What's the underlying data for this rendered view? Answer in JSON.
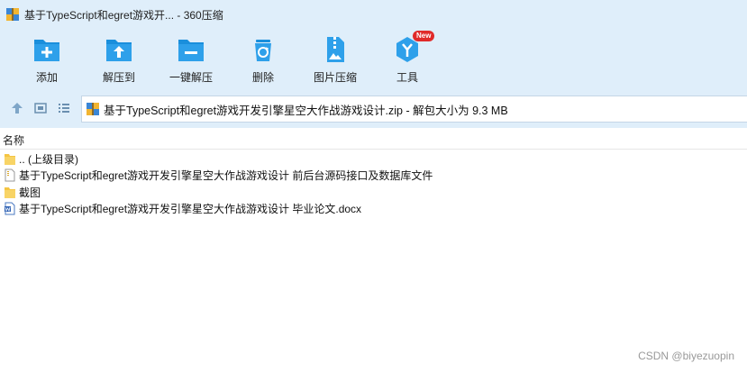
{
  "window": {
    "title": "基于TypeScript和egret游戏开... - 360压缩"
  },
  "toolbar": {
    "items": [
      {
        "label": "添加",
        "icon": "add-icon"
      },
      {
        "label": "解压到",
        "icon": "extract-to-icon"
      },
      {
        "label": "一键解压",
        "icon": "one-click-extract-icon"
      },
      {
        "label": "删除",
        "icon": "delete-icon"
      },
      {
        "label": "图片压缩",
        "icon": "image-compress-icon"
      },
      {
        "label": "工具",
        "icon": "tools-icon",
        "badge": "New"
      }
    ]
  },
  "address": {
    "path": "基于TypeScript和egret游戏开发引擎星空大作战游戏设计.zip - 解包大小为 9.3 MB"
  },
  "list": {
    "column_name": "名称",
    "rows": [
      {
        "label": ".. (上级目录)",
        "icon": "folder-icon"
      },
      {
        "label": "基于TypeScript和egret游戏开发引擎星空大作战游戏设计 前后台源码接口及数据库文件",
        "icon": "file-icon"
      },
      {
        "label": "截图",
        "icon": "folder-icon"
      },
      {
        "label": "基于TypeScript和egret游戏开发引擎星空大作战游戏设计 毕业论文.docx",
        "icon": "word-doc-icon"
      }
    ]
  },
  "watermark": "CSDN @biyezuopin",
  "colors": {
    "accent": "#1a8fdc",
    "toolbar_bg": "#dfeefa",
    "badge": "#e02a2a",
    "folder": "#f5c542"
  }
}
